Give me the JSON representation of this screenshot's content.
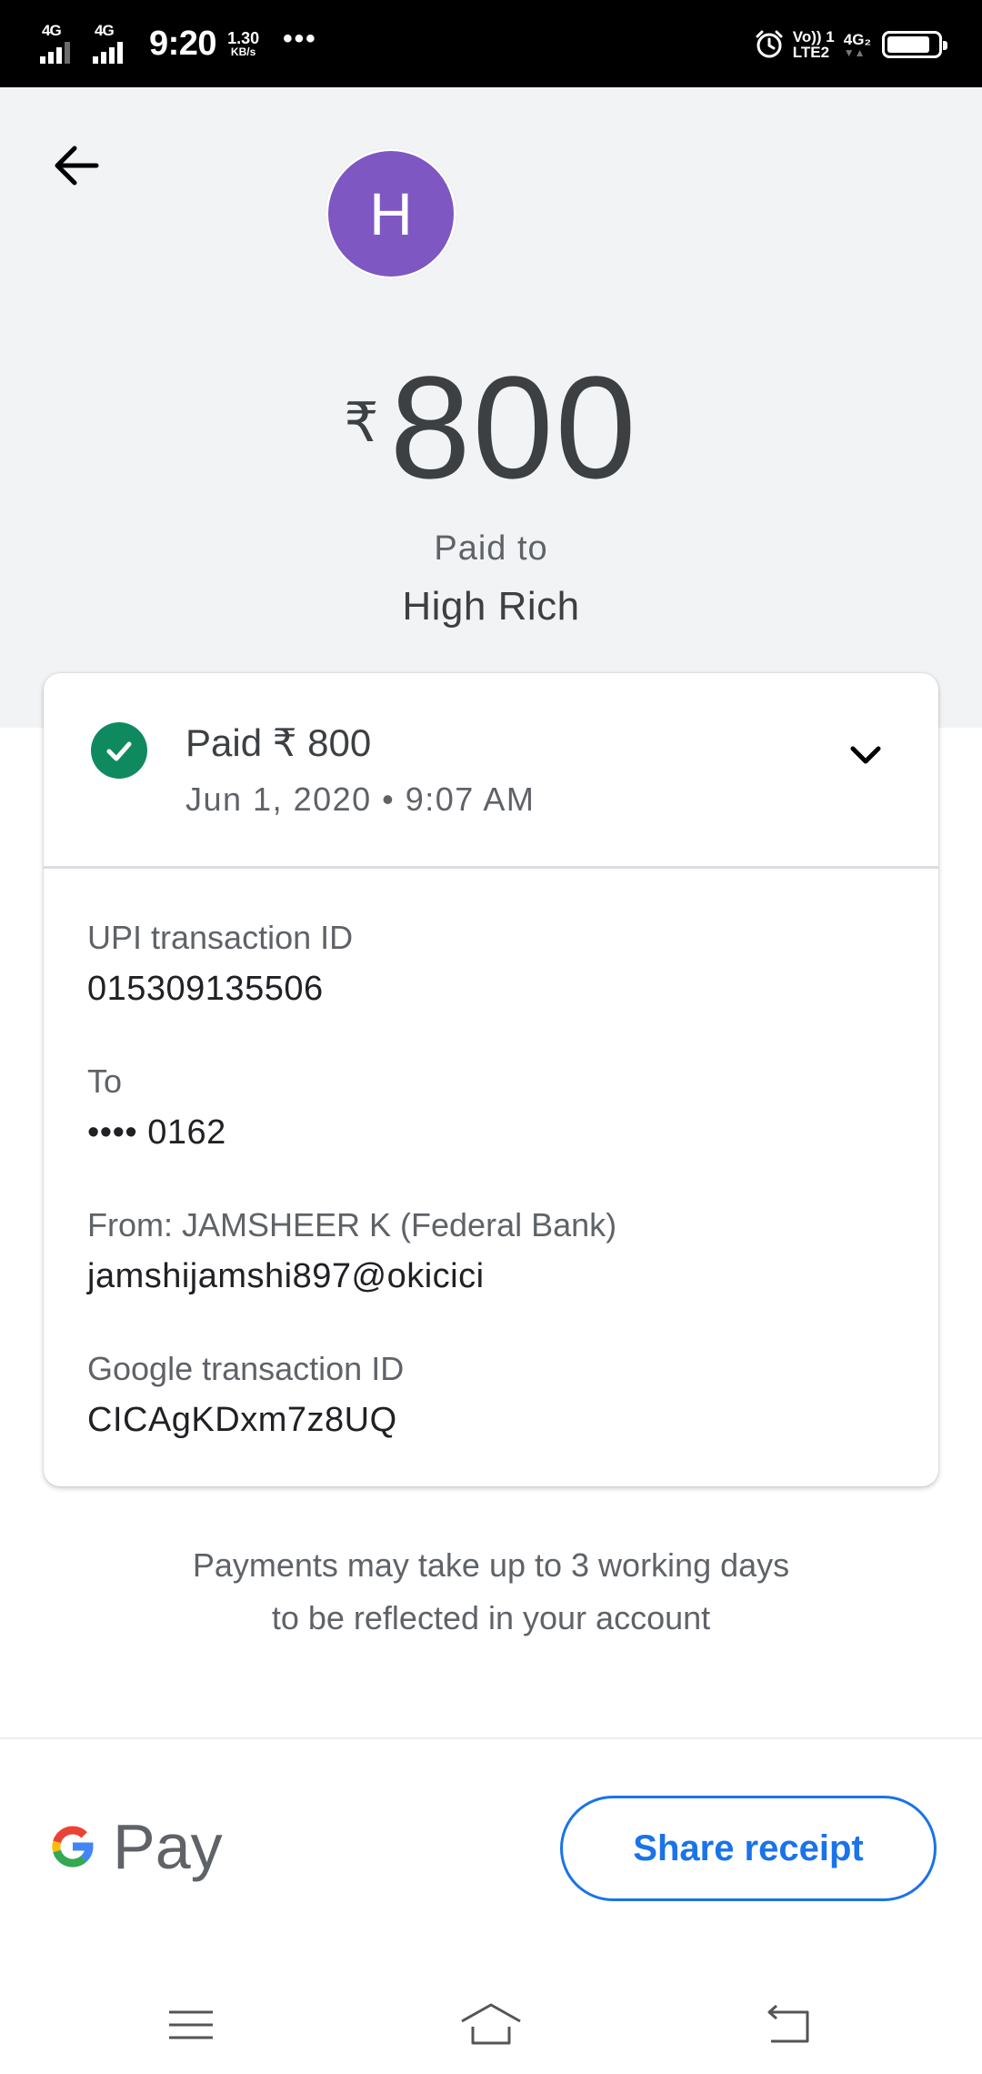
{
  "status_bar": {
    "net1": "4G",
    "net2": "4G",
    "time": "9:20",
    "speed_value": "1.30",
    "speed_unit": "KB/s",
    "more": "•••",
    "volte_top": "Vo)) 1",
    "volte_bottom": "LTE2",
    "net_right": "4G₂",
    "net_right_sub": "▼▲",
    "battery_level": 0.85
  },
  "header": {
    "avatar_letter": "H",
    "currency": "₹",
    "amount": "800",
    "paid_to_label": "Paid to",
    "payee_name": "High Rich"
  },
  "card": {
    "status_title": "Paid ₹ 800",
    "date_time": "Jun 1, 2020 • 9:07 AM",
    "details": [
      {
        "label": "UPI transaction ID",
        "value": "015309135506"
      },
      {
        "label": "To",
        "value": "•••• 0162"
      },
      {
        "label": "From: JAMSHEER K (Federal Bank)",
        "value": "jamshijamshi897@okicici"
      },
      {
        "label": "Google transaction ID",
        "value": "CICAgKDxm7z8UQ"
      }
    ]
  },
  "note": {
    "line1": "Payments may take up to 3 working days",
    "line2": "to be reflected in your account"
  },
  "footer": {
    "brand": "Pay",
    "share_label": "Share receipt"
  },
  "colors": {
    "header_bg": "#f1f3f4",
    "avatar": "#7e57c2",
    "success": "#0f8a5f",
    "accent": "#1a73e8"
  },
  "icons": {
    "back": "arrow-left-icon",
    "check": "check-circle-icon",
    "expand": "chevron-down-icon",
    "nav_menu": "menu-icon",
    "nav_home": "home-icon",
    "nav_back": "back-icon"
  }
}
